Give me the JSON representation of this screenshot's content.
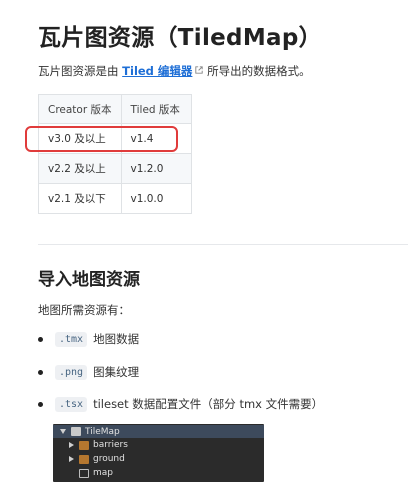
{
  "heading": "瓦片图资源（TiledMap）",
  "intro": {
    "prefix": "瓦片图资源是由 ",
    "link_text": "Tiled 编辑器",
    "suffix": " 所导出的数据格式。"
  },
  "version_table": {
    "headers": [
      "Creator 版本",
      "Tiled 版本"
    ],
    "rows": [
      [
        "v3.0 及以上",
        "v1.4"
      ],
      [
        "v2.2 及以上",
        "v1.2.0"
      ],
      [
        "v2.1 及以下",
        "v1.0.0"
      ]
    ]
  },
  "section": {
    "title": "导入地图资源",
    "needs_text": "地图所需资源有：",
    "items": [
      {
        "code": ".tmx",
        "text": "地图数据"
      },
      {
        "code": ".png",
        "text": "图集纹理"
      },
      {
        "code": ".tsx",
        "text": "tileset 数据配置文件（部分 tmx 文件需要）"
      }
    ]
  },
  "asset_tree": {
    "root": "TileMap",
    "children": [
      {
        "label": "barriers",
        "icon": "tileset-icon",
        "expandable": true
      },
      {
        "label": "ground",
        "icon": "tileset-icon",
        "expandable": true
      },
      {
        "label": "map",
        "icon": "map-file-icon",
        "expandable": false
      }
    ]
  },
  "colors": {
    "link": "#1f6fd6",
    "highlight_box": "#e03b3b",
    "code_text": "#476582",
    "tree_bg": "#2b2b2b"
  }
}
